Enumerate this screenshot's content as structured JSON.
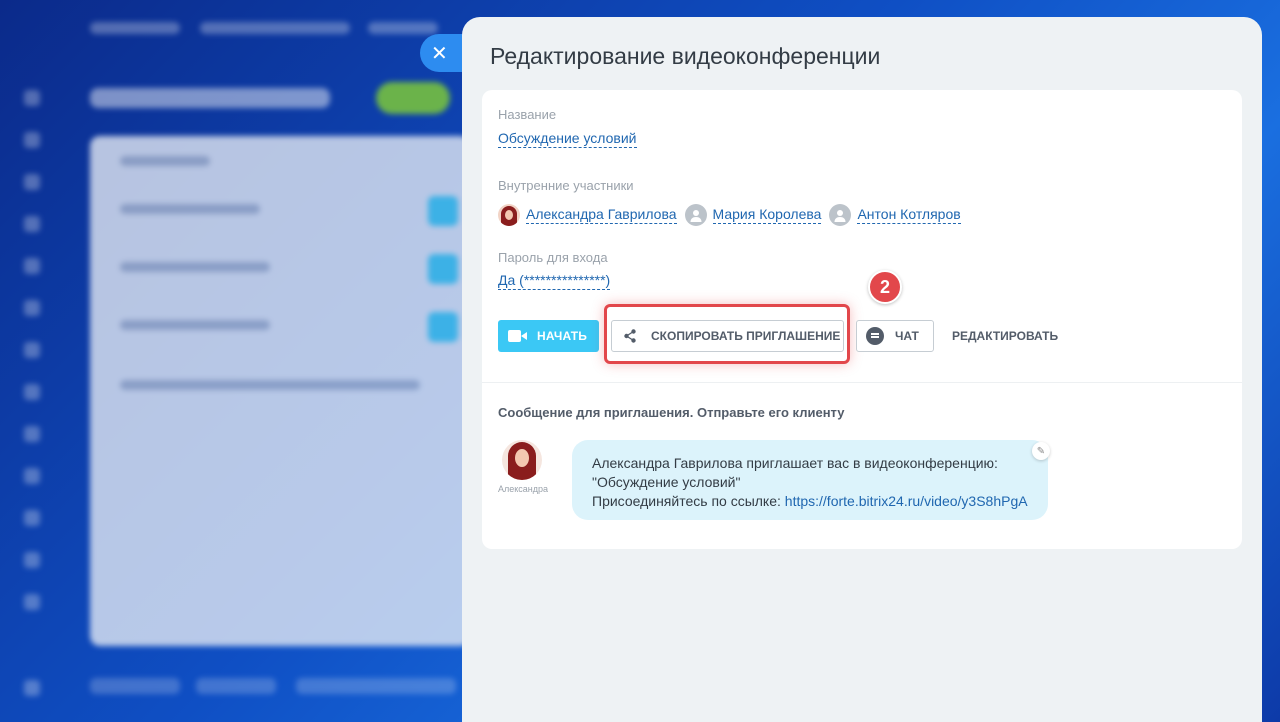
{
  "slider": {
    "title": "Редактирование видеоконференции",
    "close_icon": "close-icon"
  },
  "conference": {
    "name_label": "Название",
    "name_value": "Обсуждение условий",
    "members_label": "Внутренние участники",
    "members": [
      {
        "name": "Александра Гаврилова",
        "avatar": "photo"
      },
      {
        "name": "Мария Королева",
        "avatar": "generic-user-icon"
      },
      {
        "name": "Антон Котляров",
        "avatar": "generic-user-icon"
      }
    ],
    "password_label": "Пароль для входа",
    "password_value": "Да (***************)"
  },
  "actions": {
    "start": "НАЧАТЬ",
    "copy_invite": "СКОПИРОВАТЬ ПРИГЛАШЕНИЕ",
    "chat": "ЧАТ",
    "edit": "РЕДАКТИРОВАТЬ",
    "step_badge": "2"
  },
  "invite": {
    "heading": "Сообщение для приглашения. Отправьте его клиенту",
    "sender_name": "Александра",
    "line1": "Александра Гаврилова приглашает вас в видеоконференцию:",
    "line2": "\"Обсуждение условий\"",
    "line3_prefix": "Присоединяйтесь по ссылке: ",
    "link": "https://forte.bitrix24.ru/video/y3S8hPgA"
  },
  "colors": {
    "accent": "#3bc8f5",
    "link": "#2067b0",
    "highlight": "#e2474b",
    "bubble": "#dcf3fb"
  }
}
